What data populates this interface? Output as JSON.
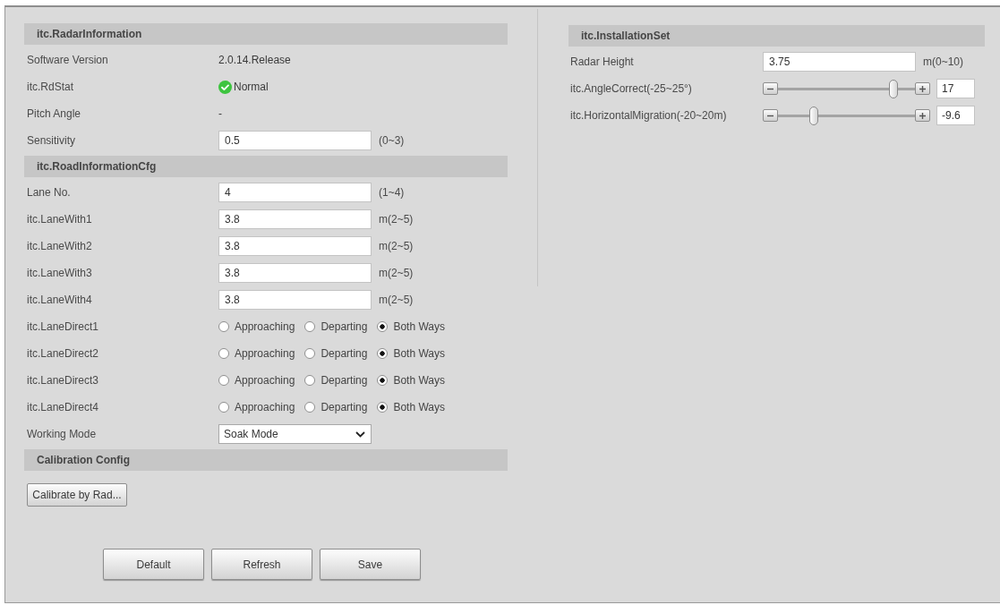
{
  "left_sections": [
    {
      "title": "itc.RadarInformation",
      "rows": [
        {
          "kind": "text",
          "label": "Software Version",
          "value": "2.0.14.Release"
        },
        {
          "kind": "status",
          "label": "itc.RdStat",
          "value": "Normal"
        },
        {
          "kind": "text",
          "label": "Pitch Angle",
          "value": "-"
        },
        {
          "kind": "input",
          "label": "Sensitivity",
          "value": "0.5",
          "hint": "(0~3)"
        }
      ]
    },
    {
      "title": "itc.RoadInformationCfg",
      "rows": [
        {
          "kind": "input",
          "label": "Lane No.",
          "value": "4",
          "hint": "(1~4)"
        },
        {
          "kind": "input",
          "label": "itc.LaneWith1",
          "value": "3.8",
          "hint": "m(2~5)"
        },
        {
          "kind": "input",
          "label": "itc.LaneWith2",
          "value": "3.8",
          "hint": "m(2~5)"
        },
        {
          "kind": "input",
          "label": "itc.LaneWith3",
          "value": "3.8",
          "hint": "m(2~5)"
        },
        {
          "kind": "input",
          "label": "itc.LaneWith4",
          "value": "3.8",
          "hint": "m(2~5)"
        },
        {
          "kind": "radio",
          "label": "itc.LaneDirect1",
          "options": [
            {
              "label": "Approaching",
              "selected": false
            },
            {
              "label": "Departing",
              "selected": false
            },
            {
              "label": "Both Ways",
              "selected": true
            }
          ]
        },
        {
          "kind": "radio",
          "label": "itc.LaneDirect2",
          "options": [
            {
              "label": "Approaching",
              "selected": false
            },
            {
              "label": "Departing",
              "selected": false
            },
            {
              "label": "Both Ways",
              "selected": true
            }
          ]
        },
        {
          "kind": "radio",
          "label": "itc.LaneDirect3",
          "options": [
            {
              "label": "Approaching",
              "selected": false
            },
            {
              "label": "Departing",
              "selected": false
            },
            {
              "label": "Both Ways",
              "selected": true
            }
          ]
        },
        {
          "kind": "radio",
          "label": "itc.LaneDirect4",
          "options": [
            {
              "label": "Approaching",
              "selected": false
            },
            {
              "label": "Departing",
              "selected": false
            },
            {
              "label": "Both Ways",
              "selected": true
            }
          ]
        },
        {
          "kind": "select",
          "label": "Working Mode",
          "value": "Soak Mode"
        }
      ]
    },
    {
      "title": "Calibration Config",
      "rows": [
        {
          "kind": "button",
          "label": "Calibrate by Rad..."
        }
      ]
    }
  ],
  "footer_buttons": [
    "Default",
    "Refresh",
    "Save"
  ],
  "right_sections": [
    {
      "title": "itc.InstallationSet",
      "rows": [
        {
          "kind": "input",
          "label": "Radar Height",
          "value": "3.75",
          "hint": "m(0~10)"
        },
        {
          "kind": "slider",
          "label": "itc.AngleCorrect(-25~25°)",
          "level": 0.84,
          "value": "17"
        },
        {
          "kind": "slider",
          "label": "itc.HorizontalMigration(-20~20m)",
          "level": 0.26,
          "value": "-9.6"
        }
      ]
    }
  ]
}
